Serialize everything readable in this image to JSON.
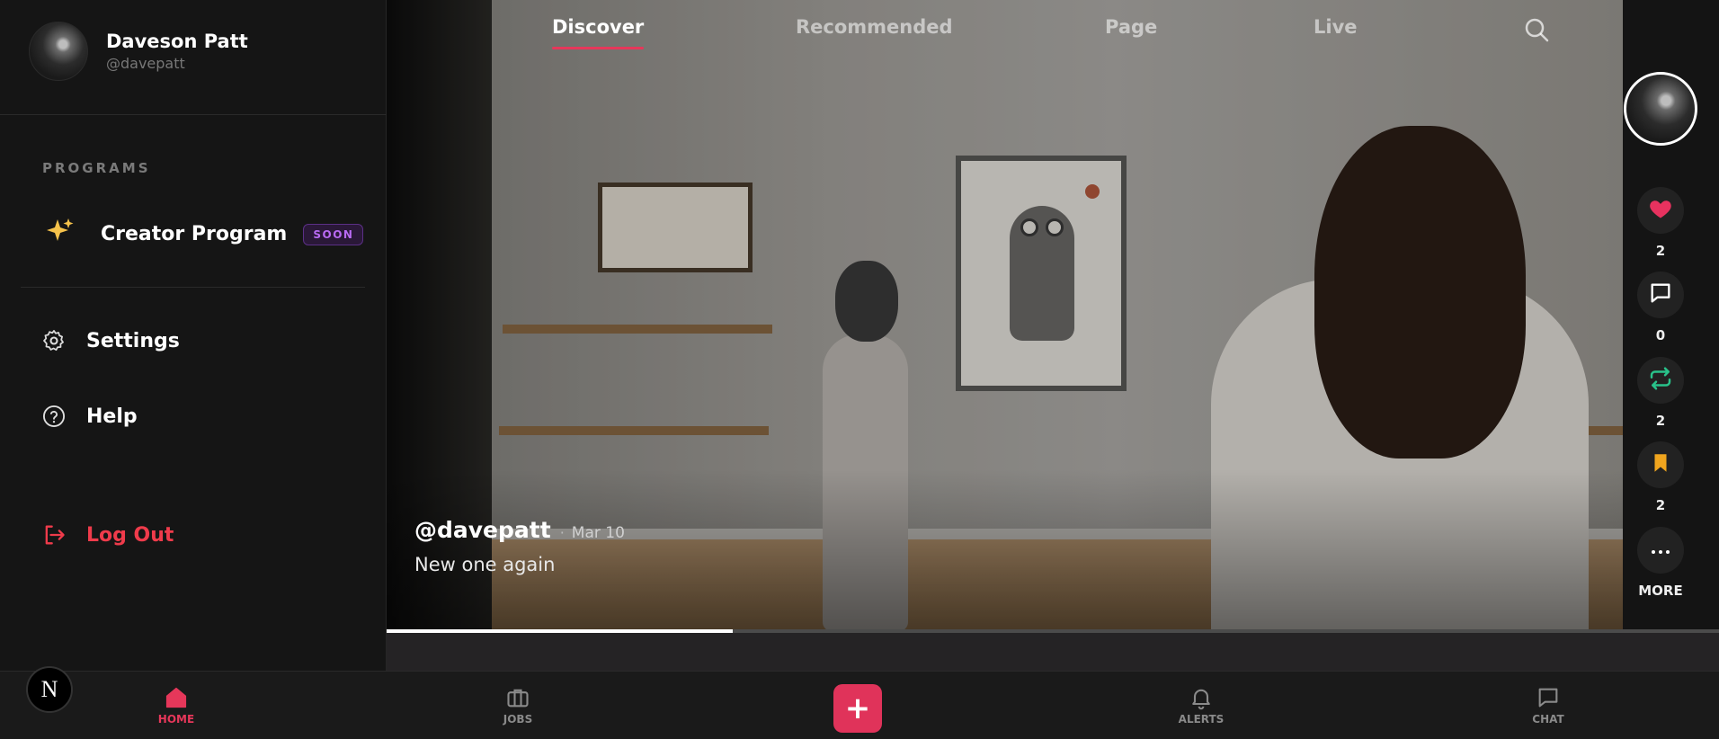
{
  "profile": {
    "name": "Daveson Patt",
    "handle": "@davepatt"
  },
  "sidebar": {
    "section_title": "PROGRAMS",
    "creator_program": {
      "label": "Creator Program",
      "badge": "SOON",
      "icon": "sparkles-icon"
    },
    "settings_label": "Settings",
    "help_label": "Help",
    "logout_label": "Log Out"
  },
  "tabs": [
    {
      "label": "Discover",
      "active": true
    },
    {
      "label": "Recommended",
      "active": false
    },
    {
      "label": "Page",
      "active": false
    },
    {
      "label": "Live",
      "active": false
    }
  ],
  "post": {
    "username": "@davepatt",
    "separator": "·",
    "date": "Mar 10",
    "caption": "New one again",
    "progress_percent": 26
  },
  "actions": {
    "likes": "2",
    "comments": "0",
    "reposts": "2",
    "saves": "2",
    "more_label": "MORE"
  },
  "bottom_nav": {
    "home": "HOME",
    "jobs": "JOBS",
    "create": "+",
    "alerts": "ALERTS",
    "chat": "CHAT"
  },
  "logo": "N",
  "colors": {
    "accent": "#e6375a",
    "like": "#e7325f",
    "repost": "#29c28a",
    "save": "#f0a51e",
    "logout": "#ef3b4b",
    "badge": "#b96af3"
  }
}
